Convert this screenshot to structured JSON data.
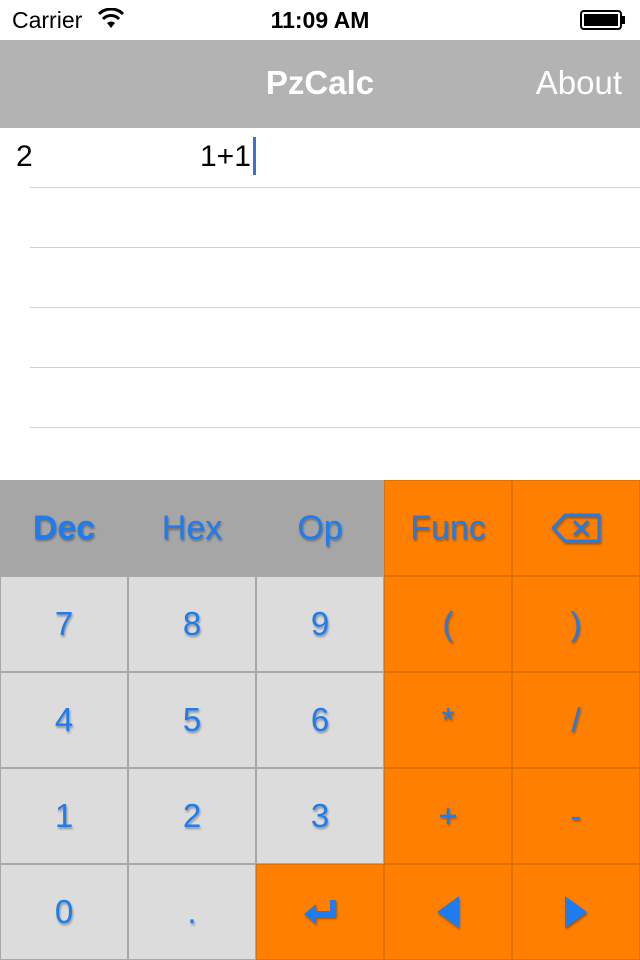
{
  "status_bar": {
    "carrier": "Carrier",
    "time": "11:09 AM"
  },
  "nav": {
    "title": "PzCalc",
    "about_label": "About"
  },
  "history": [
    {
      "result": "2",
      "expression": "1+1"
    }
  ],
  "keypad": {
    "mode_tabs": {
      "dec": "Dec",
      "hex": "Hex",
      "op": "Op",
      "active": "Dec"
    },
    "func_label": "Func",
    "backspace_icon": "backspace-icon",
    "digits": {
      "k7": "7",
      "k8": "8",
      "k9": "9",
      "k4": "4",
      "k5": "5",
      "k6": "6",
      "k1": "1",
      "k2": "2",
      "k3": "3",
      "k0": "0",
      "dot": "."
    },
    "ops": {
      "lparen": "(",
      "rparen": ")",
      "mul": "*",
      "div": "/",
      "plus": "+",
      "minus": "-"
    },
    "enter_icon": "return-icon",
    "left_icon": "arrow-left-icon",
    "right_icon": "arrow-right-icon"
  },
  "colors": {
    "nav_bg": "#b3b3b3",
    "key_text": "#1e7cf0",
    "orange": "#ff8000",
    "gray_key": "#dcdcdc",
    "tab_bg": "#a6a6a6"
  }
}
